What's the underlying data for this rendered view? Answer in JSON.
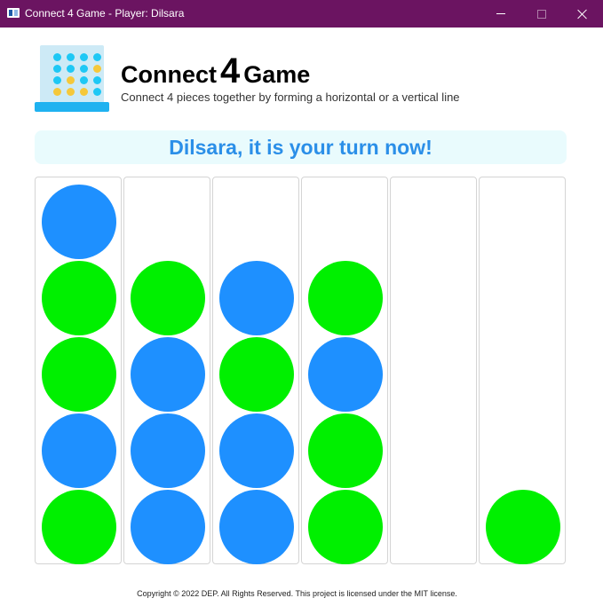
{
  "window": {
    "title": "Connect 4 Game - Player: Dilsara"
  },
  "header": {
    "title_prefix": "Connect",
    "title_number": "4",
    "title_suffix": "Game",
    "subtitle": "Connect 4 pieces together by forming a horizontal or a vertical line",
    "logo_icon": "connect-four-board-icon"
  },
  "status": {
    "message": "Dilsara, it is your turn now!"
  },
  "colors": {
    "titlebar": "#6b1461",
    "blue_piece": "#1e90ff",
    "green_piece": "#00f000",
    "banner_text": "#2b8fe8",
    "banner_bg": "#e9fbfd"
  },
  "board": {
    "rows": 5,
    "columns": [
      [
        "blue",
        "green",
        "green",
        "blue",
        "green"
      ],
      [
        null,
        "green",
        "blue",
        "blue",
        "blue"
      ],
      [
        null,
        "blue",
        "green",
        "blue",
        "blue"
      ],
      [
        null,
        "green",
        "blue",
        "green",
        "green"
      ],
      [
        null,
        null,
        null,
        null,
        null
      ],
      [
        null,
        null,
        null,
        null,
        "green"
      ]
    ]
  },
  "footer": {
    "text": "Copyright © 2022 DEP. All Rights Reserved. This project is licensed under the MIT license."
  }
}
